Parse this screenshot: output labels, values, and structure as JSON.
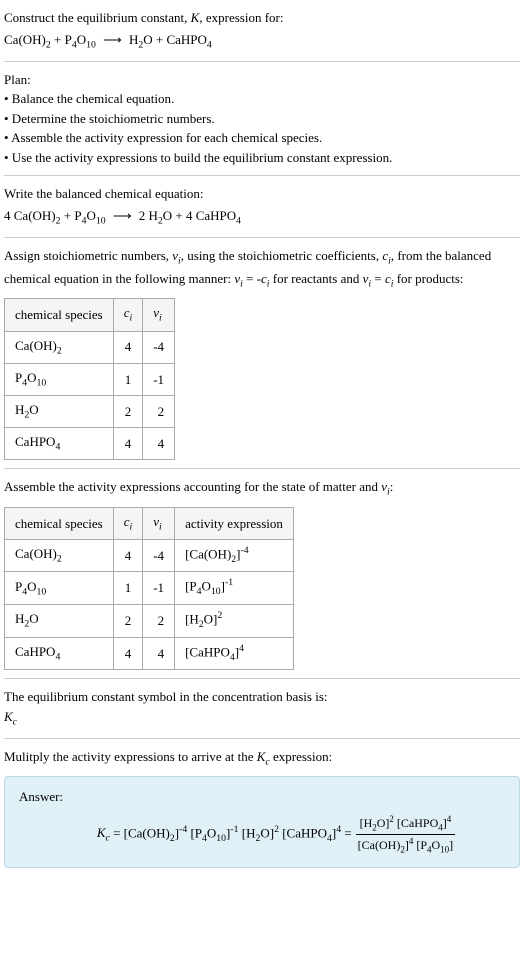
{
  "header": {
    "line1": "Construct the equilibrium constant, K, expression for:",
    "equation_unbalanced": "Ca(OH)₂ + P₄O₁₀ ⟶ H₂O + CaHPO₄"
  },
  "plan": {
    "title": "Plan:",
    "items": [
      "• Balance the chemical equation.",
      "• Determine the stoichiometric numbers.",
      "• Assemble the activity expression for each chemical species.",
      "• Use the activity expressions to build the equilibrium constant expression."
    ]
  },
  "balanced": {
    "intro": "Write the balanced chemical equation:",
    "equation": "4 Ca(OH)₂ + P₄O₁₀ ⟶ 2 H₂O + 4 CaHPO₄"
  },
  "stoich": {
    "intro_part1": "Assign stoichiometric numbers, νᵢ, using the stoichiometric coefficients, cᵢ, from the balanced chemical equation in the following manner: νᵢ = -cᵢ for reactants and νᵢ = cᵢ for products:",
    "headers": {
      "species": "chemical species",
      "ci": "cᵢ",
      "vi": "νᵢ"
    },
    "rows": [
      {
        "species": "Ca(OH)₂",
        "ci": "4",
        "vi": "-4"
      },
      {
        "species": "P₄O₁₀",
        "ci": "1",
        "vi": "-1"
      },
      {
        "species": "H₂O",
        "ci": "2",
        "vi": "2"
      },
      {
        "species": "CaHPO₄",
        "ci": "4",
        "vi": "4"
      }
    ]
  },
  "activity": {
    "intro": "Assemble the activity expressions accounting for the state of matter and νᵢ:",
    "headers": {
      "species": "chemical species",
      "ci": "cᵢ",
      "vi": "νᵢ",
      "expr": "activity expression"
    },
    "rows": [
      {
        "species": "Ca(OH)₂",
        "ci": "4",
        "vi": "-4",
        "expr": "[Ca(OH)₂]⁻⁴"
      },
      {
        "species": "P₄O₁₀",
        "ci": "1",
        "vi": "-1",
        "expr": "[P₄O₁₀]⁻¹"
      },
      {
        "species": "H₂O",
        "ci": "2",
        "vi": "2",
        "expr": "[H₂O]²"
      },
      {
        "species": "CaHPO₄",
        "ci": "4",
        "vi": "4",
        "expr": "[CaHPO₄]⁴"
      }
    ]
  },
  "symbol": {
    "line1": "The equilibrium constant symbol in the concentration basis is:",
    "line2": "K_c"
  },
  "multiply": {
    "intro": "Mulitply the activity expressions to arrive at the K_c expression:"
  },
  "answer": {
    "label": "Answer:",
    "lhs": "K_c = [Ca(OH)₂]⁻⁴ [P₄O₁₀]⁻¹ [H₂O]² [CaHPO₄]⁴ = ",
    "frac_num": "[H₂O]² [CaHPO₄]⁴",
    "frac_den": "[Ca(OH)₂]⁴ [P₄O₁₀]"
  }
}
